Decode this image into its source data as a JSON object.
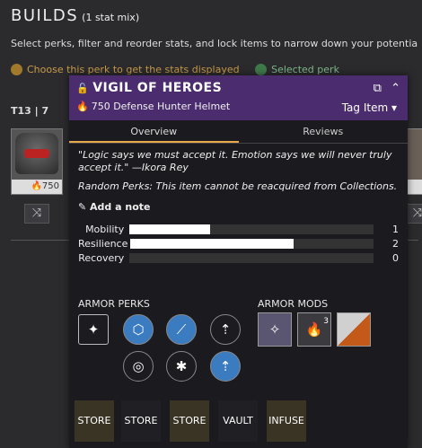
{
  "page": {
    "title": "BUILDS",
    "subtitle": "(1 stat mix)",
    "instructions": "Select perks, filter and reorder stats, and lock items to narrow down your potentia",
    "legend_choose": "Choose this perk to get the stats displayed",
    "legend_selected": "Selected perk",
    "tier": "T13 | 7"
  },
  "item_card": {
    "power": "750"
  },
  "popup": {
    "name": "VIGIL OF HEROES",
    "type_line": "750 Defense Hunter Helmet",
    "tag_label": "Tag Item",
    "tabs": [
      {
        "label": "Overview"
      },
      {
        "label": "Reviews"
      }
    ],
    "flavor": "\"Logic says we must accept it. Emotion says we will never truly accept it.\" —Ikora Rey",
    "random_perks_note": "Random Perks: This item cannot be reacquired from Collections.",
    "add_note": "Add a note",
    "stats": [
      {
        "label": "Mobility",
        "value": 1,
        "fill": 0.33
      },
      {
        "label": "Resilience",
        "value": 2,
        "fill": 0.67
      },
      {
        "label": "Recovery",
        "value": 0,
        "fill": 0
      }
    ],
    "armor_perks_label": "ARMOR PERKS",
    "armor_mods_label": "ARMOR MODS",
    "mod_level": "3",
    "buttons": [
      {
        "label": "STORE"
      },
      {
        "label": "STORE"
      },
      {
        "label": "STORE"
      },
      {
        "label": "VAULT"
      },
      {
        "label": "INFUSE"
      }
    ],
    "colors": {
      "header": "#4b2c6f",
      "accent": "#e8a94a",
      "power": "#e96a1e"
    }
  }
}
